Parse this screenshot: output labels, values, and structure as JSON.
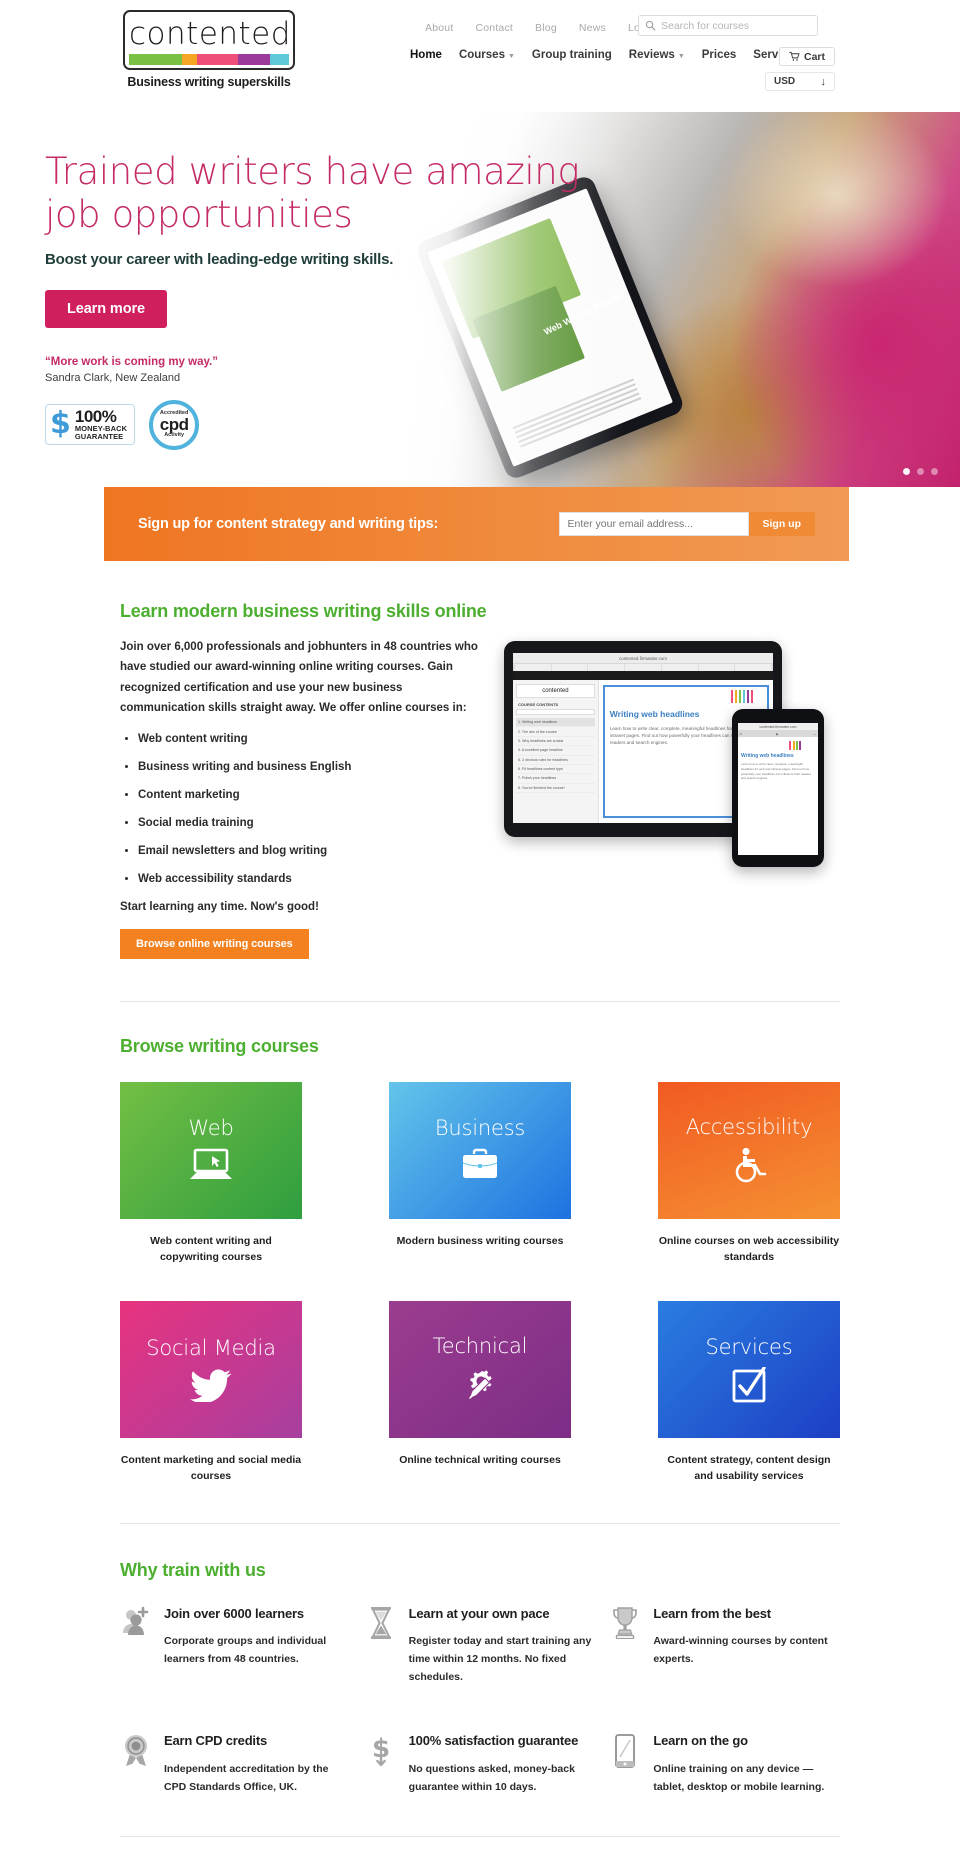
{
  "header": {
    "logo": {
      "word": "contented",
      "tagline": "Business writing superskills",
      "bar_colors": [
        "#7ac143",
        "#f5a623",
        "#ef4e79",
        "#9b3a9b",
        "#5fc8d8"
      ]
    },
    "top_links": [
      "About",
      "Contact",
      "Blog",
      "News",
      "Login"
    ],
    "search": {
      "placeholder": "Search for courses",
      "icon": "search-icon"
    },
    "nav": [
      {
        "label": "Home",
        "caret": false,
        "active": true
      },
      {
        "label": "Courses",
        "caret": true,
        "active": false
      },
      {
        "label": "Group training",
        "caret": false,
        "active": false
      },
      {
        "label": "Reviews",
        "caret": true,
        "active": false
      },
      {
        "label": "Prices",
        "caret": false,
        "active": false
      },
      {
        "label": "Services",
        "caret": false,
        "active": false
      }
    ],
    "cart_label": "Cart",
    "cart_icon": "cart-icon",
    "currency_value": "USD",
    "currency_icon": "arrow-down-icon"
  },
  "hero": {
    "heading": "Trained writers have amazing job opportunities",
    "subheading": "Boost your career with leading-edge writing skills.",
    "cta_label": "Learn more",
    "quote": "“More work is coming my way.”",
    "quote_author": "Sandra Clark, New Zealand",
    "badge_money_back": {
      "percent": "100%",
      "line1": "MONEY-BACK",
      "line2": "GUARANTEE",
      "symbol": "$"
    },
    "badge_cpd": {
      "top": "Accredited",
      "main": "cpd",
      "bottom": "Activity"
    },
    "tablet_label": "Web Writing Bundle",
    "carousel": {
      "total": 3,
      "active": 1
    },
    "heading_color": "#c42a66",
    "cta_color": "#cf1f5f"
  },
  "signup": {
    "label": "Sign up for content strategy and writing tips:",
    "input_placeholder": "Enter your email address...",
    "input_value": "",
    "button_label": "Sign up",
    "bar_color": "#ef7521"
  },
  "intro": {
    "title": "Learn modern business writing skills online",
    "paragraph": "Join over 6,000 professionals and jobhunters in 48 countries who have studied our award-winning online writing courses. Gain recognized certification and use your new business communication skills straight away. We offer online courses in:",
    "bullets": [
      "Web content writing",
      "Business writing and business English",
      "Content marketing",
      "Social media training",
      "Email newsletters and blog writing",
      "Web accessibility standards"
    ],
    "closing": "Start learning any time. Now's good!",
    "button_label": "Browse online writing courses",
    "button_color": "#f48120",
    "title_color": "#4caf2f",
    "device_preview": {
      "browser_url": "contented.firmwater.com",
      "course_contents_label": "COURSE CONTENTS",
      "search_placeholder": "Search...",
      "exit_label": "Exit course",
      "logo": "contented",
      "slide_title": "Writing web headlines",
      "slide_body": "Learn how to write clear, complete, meaningful headlines for web and intranet pages. Find out how powerfully your headlines can influence both readers and search engines.",
      "contents": [
        "1. Writing web headlines",
        "2. The aim of the course",
        "3. Why headlines are crucial",
        "4. A excellent page headline",
        "5. 3 obvious rules for headlines",
        "6. Fit headlines content type",
        "7. Polish your headlines",
        "8. You've finished the course!"
      ]
    }
  },
  "browse": {
    "title": "Browse writing courses",
    "title_color": "#4caf2f",
    "tiles": [
      {
        "label": "Web",
        "caption": "Web content writing and copywriting courses",
        "icon": "laptop-icon",
        "color_from": "#73bf44",
        "color_to": "#2f9e3f"
      },
      {
        "label": "Business",
        "caption": "Modern business writing courses",
        "icon": "briefcase-icon",
        "color_from": "#63c5ea",
        "color_to": "#1f72e0"
      },
      {
        "label": "Accessibility",
        "caption": "Online courses on web accessibility standards",
        "icon": "wheelchair-icon",
        "color_from": "#f15a22",
        "color_to": "#f59132"
      },
      {
        "label": "Social Media",
        "caption": "Content marketing and social media courses",
        "icon": "twitter-bird-icon",
        "color_from": "#e8337f",
        "color_to": "#b23b9b"
      },
      {
        "label": "Technical",
        "caption": "Online technical writing courses",
        "icon": "gear-pen-icon",
        "color_from": "#9b3d8f",
        "color_to": "#7c2d86"
      },
      {
        "label": "Services",
        "caption": "Content strategy, content design and usability services",
        "icon": "checkbox-icon",
        "color_from": "#2a7de1",
        "color_to": "#1d3fc4"
      }
    ]
  },
  "why": {
    "title": "Why train with us",
    "title_color": "#4caf2f",
    "items": [
      {
        "icon": "add-user-icon",
        "heading": "Join over 6000 learners",
        "text": "Corporate groups and individual learners from 48 countries."
      },
      {
        "icon": "hourglass-icon",
        "heading": "Learn at your own pace",
        "text": "Register today and start training any time within 12 months. No fixed schedules."
      },
      {
        "icon": "trophy-icon",
        "heading": "Learn from the best",
        "text": "Award-winning courses by content experts."
      },
      {
        "icon": "award-ribbon-icon",
        "heading": "Earn CPD credits",
        "text": "Independent accreditation by the CPD Standards Office, UK."
      },
      {
        "icon": "dollar-icon",
        "heading": "100% satisfaction guarantee",
        "text": "No questions asked, money-back guarantee within 10 days."
      },
      {
        "icon": "mobile-phone-icon",
        "heading": "Learn on the go",
        "text": "Online training on any device — tablet, desktop or mobile learning."
      }
    ]
  }
}
